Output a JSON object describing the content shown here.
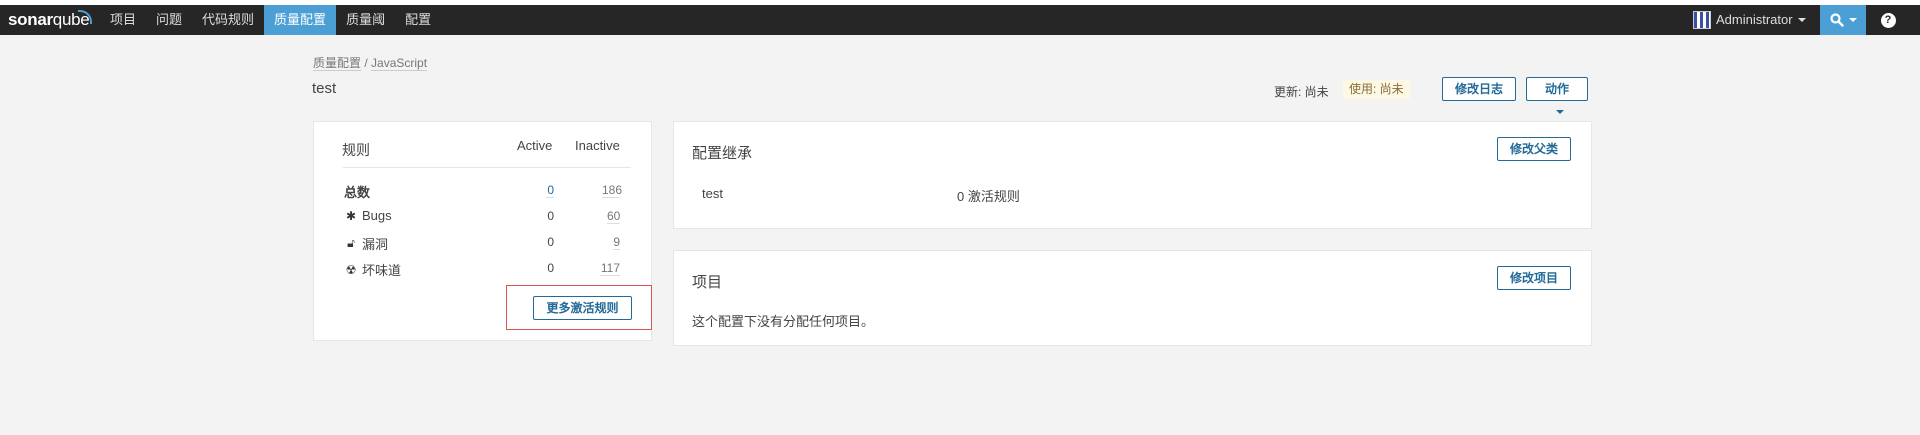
{
  "nav": {
    "logo_main": "sonar",
    "logo_sub": "qube",
    "items": [
      "项目",
      "问题",
      "代码规则",
      "质量配置",
      "质量阈",
      "配置"
    ],
    "user_name": "Administrator"
  },
  "breadcrumb": {
    "root": "质量配置",
    "separator": "/",
    "current": "JavaScript"
  },
  "title": "test",
  "meta": {
    "updated": "更新: 尚未",
    "used": "使用: 尚未"
  },
  "buttons": {
    "changelog": "修改日志",
    "actions": "动作",
    "change_parent": "修改父类",
    "change_projects": "修改项目",
    "activate_more": "更多激活规则"
  },
  "rules": {
    "title": "规则",
    "col_active": "Active",
    "col_inactive": "Inactive",
    "rows": [
      {
        "label": "总数",
        "icon": "total",
        "active": "0",
        "inactive": "186"
      },
      {
        "label": "Bugs",
        "icon": "bug-icon",
        "active": "0",
        "inactive": "60"
      },
      {
        "label": "漏洞",
        "icon": "lock-icon",
        "active": "0",
        "inactive": "9"
      },
      {
        "label": "坏味道",
        "icon": "code-smell-icon",
        "active": "0",
        "inactive": "117"
      }
    ]
  },
  "inheritance": {
    "title": "配置继承",
    "profile_name": "test",
    "active_rules": "0 激活规则"
  },
  "projects": {
    "title": "项目",
    "empty_message": "这个配置下没有分配任何项目。"
  },
  "colors": {
    "topbar": "#262626",
    "accent": "#4b9fd5",
    "button": "#236a97",
    "highlight": "#d9534f"
  }
}
